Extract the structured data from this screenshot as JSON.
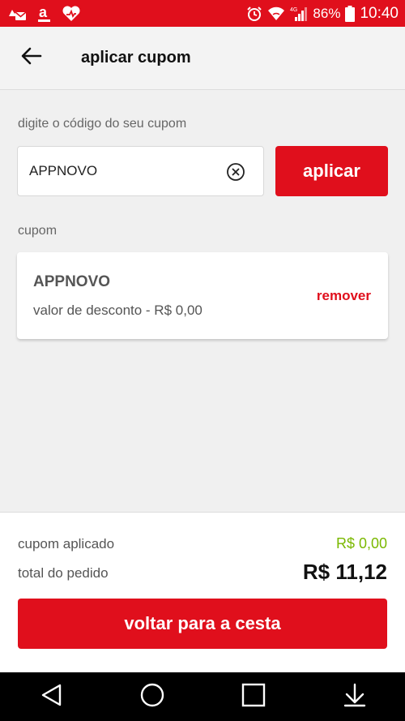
{
  "status_bar": {
    "battery": "86%",
    "time": "10:40",
    "network": "4G",
    "icons": [
      "notification-app-icon",
      "amazon-a-icon",
      "heart-app-icon",
      "alarm-icon",
      "wifi-icon",
      "signal-icon",
      "battery-icon"
    ]
  },
  "header": {
    "title": "aplicar cupom",
    "back_icon": "arrow-left-icon"
  },
  "coupon_input": {
    "label": "digite o código do seu cupom",
    "value": "APPNOVO",
    "clear_icon": "clear-circle-icon",
    "apply_label": "aplicar"
  },
  "coupon_section": {
    "label": "cupom",
    "card": {
      "code": "APPNOVO",
      "discount_text": "valor de desconto - R$ 0,00",
      "remove_label": "remover"
    }
  },
  "summary": {
    "coupon_applied_label": "cupom aplicado",
    "coupon_applied_value": "R$ 0,00",
    "total_label": "total do pedido",
    "total_value": "R$ 11,12",
    "back_button_label": "voltar para a cesta"
  },
  "colors": {
    "brand_red": "#e00f1c",
    "discount_green": "#7ab800"
  },
  "nav_bar": {
    "icons": [
      "back-triangle-icon",
      "home-circle-icon",
      "recents-square-icon",
      "download-arrow-icon"
    ]
  }
}
